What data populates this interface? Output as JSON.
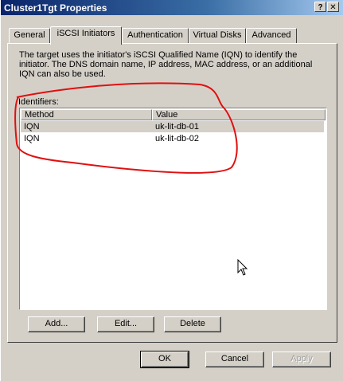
{
  "window": {
    "title": "Cluster1Tgt Properties",
    "help_glyph": "?",
    "close_glyph": "✕"
  },
  "tabs": [
    {
      "label": "General"
    },
    {
      "label": "iSCSI Initiators",
      "active": true
    },
    {
      "label": "Authentication"
    },
    {
      "label": "Virtual Disks"
    },
    {
      "label": "Advanced"
    }
  ],
  "panel": {
    "description": "The target uses the initiator's iSCSI Qualified Name (IQN) to identify the initiator. The DNS domain name, IP address, MAC address, or an additional IQN can also be used.",
    "identifiers_label": "Identifiers:",
    "columns": [
      "Method",
      "Value"
    ],
    "rows": [
      {
        "method": "IQN",
        "value": "uk-lit-db-01",
        "selected": true
      },
      {
        "method": "IQN",
        "value": "uk-lit-db-02",
        "selected": false
      }
    ],
    "buttons": {
      "add": "Add...",
      "edit": "Edit...",
      "delete": "Delete"
    }
  },
  "footer": {
    "ok": "OK",
    "cancel": "Cancel",
    "apply": "Apply"
  },
  "colors": {
    "annotation": "#e01010",
    "titlebar": "#0a246a",
    "face": "#d4d0c8"
  },
  "icons": {
    "cursor": "mouse-pointer-icon"
  }
}
